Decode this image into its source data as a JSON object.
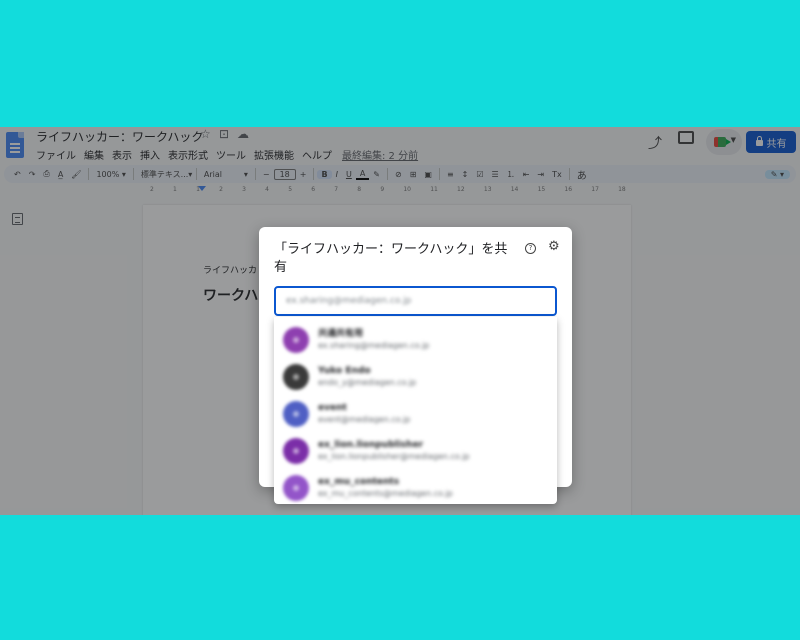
{
  "app": {
    "doc_title": "ライフハッカー：ワークハック",
    "menu": [
      "ファイル",
      "編集",
      "表示",
      "挿入",
      "表示形式",
      "ツール",
      "拡張機能",
      "ヘルプ"
    ],
    "last_edit": "最終編集: 2 分前",
    "share_label": "共有",
    "star_glyph": "☆",
    "folder_glyph": "⊡",
    "cloud_glyph": "☁",
    "trend_glyph": "⤴"
  },
  "toolbar": {
    "undo": "↶",
    "redo": "↷",
    "print": "⎙",
    "spell": "A̲",
    "paint": "🖌",
    "zoom": "100%",
    "style": "標準テキス...",
    "font": "Arial",
    "minus": "−",
    "font_size": "18",
    "plus": "+",
    "bold": "B",
    "italic": "I",
    "underline": "U",
    "text_color": "A",
    "highlight": "✎",
    "link": "⊘",
    "comment": "⊞",
    "image": "▣",
    "align": "≡",
    "line_spacing": "↕",
    "checklist": "☑",
    "bullets": "☰",
    "numbered": "⒈",
    "indent_less": "⇤",
    "indent_more": "⇥",
    "clear": "Tx",
    "input_tools": "あ",
    "edit_mode": "✎"
  },
  "ruler": [
    "2",
    "1",
    "1",
    "2",
    "3",
    "4",
    "5",
    "6",
    "7",
    "8",
    "9",
    "10",
    "11",
    "12",
    "13",
    "14",
    "15",
    "16",
    "17",
    "18"
  ],
  "page": {
    "subtitle": "ライフハッカ",
    "heading": "ワークハ"
  },
  "dialog": {
    "title": "「ライフハッカー：ワークハック」を共有",
    "help_glyph": "?",
    "gear_glyph": "⚙",
    "input_value": "ex.sharing@mediagen.co.jp"
  },
  "contacts": [
    {
      "name": "共通共有用",
      "email": "ex.sharing@mediagen.co.jp",
      "color": "#8e3fb0"
    },
    {
      "name": "Yuko Endo",
      "email": "endo_y@mediagen.co.jp",
      "color": "#3a3a3a"
    },
    {
      "name": "event",
      "email": "event@mediagen.co.jp",
      "color": "#4f5fc4"
    },
    {
      "name": "ex_lion.lionpublisher",
      "email": "ex_lion.lionpublisher@mediagen.co.jp",
      "color": "#7b2ea8"
    },
    {
      "name": "ex_mu_contents",
      "email": "ex_mu_contents@mediagen.co.jp",
      "color": "#9355c9"
    }
  ]
}
